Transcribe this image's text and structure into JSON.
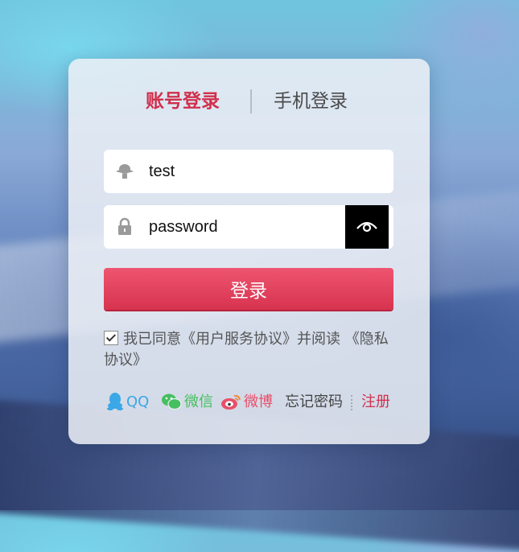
{
  "tabs": {
    "account": "账号登录",
    "phone": "手机登录"
  },
  "form": {
    "username_value": "test",
    "password_value": "password",
    "login_label": "登录"
  },
  "agreement": {
    "checked": true,
    "text": "我已同意《用户服务协议》并阅读 《隐私协议》"
  },
  "footer": {
    "qq": "QQ",
    "wechat": "微信",
    "weibo": "微博",
    "forgot": "忘记密码",
    "register": "注册"
  },
  "colors": {
    "accent": "#d12f4c",
    "qq": "#3aa7e6",
    "wechat": "#45bf5f",
    "weibo": "#e84f6a"
  },
  "icons": {
    "user": "user-icon",
    "lock": "lock-icon",
    "eye": "eye-icon",
    "qq": "qq-icon",
    "wechat": "wechat-icon",
    "weibo": "weibo-icon"
  }
}
